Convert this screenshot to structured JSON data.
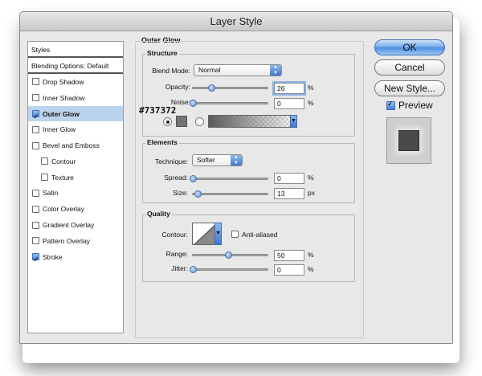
{
  "window": {
    "title": "Layer Style"
  },
  "styles_panel": {
    "header": "Styles",
    "blending_options": "Blending Options: Default",
    "items": [
      {
        "label": "Drop Shadow",
        "checked": false,
        "selected": false,
        "indent": false
      },
      {
        "label": "Inner Shadow",
        "checked": false,
        "selected": false,
        "indent": false
      },
      {
        "label": "Outer Glow",
        "checked": true,
        "selected": true,
        "indent": false
      },
      {
        "label": "Inner Glow",
        "checked": false,
        "selected": false,
        "indent": false
      },
      {
        "label": "Bevel and Emboss",
        "checked": false,
        "selected": false,
        "indent": false
      },
      {
        "label": "Contour",
        "checked": false,
        "selected": false,
        "indent": true
      },
      {
        "label": "Texture",
        "checked": false,
        "selected": false,
        "indent": true
      },
      {
        "label": "Satin",
        "checked": false,
        "selected": false,
        "indent": false
      },
      {
        "label": "Color Overlay",
        "checked": false,
        "selected": false,
        "indent": false
      },
      {
        "label": "Gradient Overlay",
        "checked": false,
        "selected": false,
        "indent": false
      },
      {
        "label": "Pattern Overlay",
        "checked": false,
        "selected": false,
        "indent": false
      },
      {
        "label": "Stroke",
        "checked": true,
        "selected": false,
        "indent": false
      }
    ]
  },
  "outer_glow": {
    "title": "Outer Glow",
    "structure": {
      "title": "Structure",
      "blend_mode_label": "Blend Mode:",
      "blend_mode_value": "Normal",
      "opacity_label": "Opacity:",
      "opacity_value": "26",
      "opacity_level": 0.26,
      "noise_label": "Noise:",
      "noise_value": "0",
      "noise_level": 0,
      "percent": "%",
      "color_annotation": "#737372",
      "glow_color": "#737372"
    },
    "elements": {
      "title": "Elements",
      "technique_label": "Technique:",
      "technique_value": "Softer",
      "spread_label": "Spread:",
      "spread_value": "0",
      "spread_level": 0,
      "spread_unit": "%",
      "size_label": "Size:",
      "size_value": "13",
      "size_level": 0.07,
      "size_unit": "px"
    },
    "quality": {
      "title": "Quality",
      "contour_label": "Contour:",
      "anti_aliased_label": "Anti-aliased",
      "range_label": "Range:",
      "range_value": "50",
      "range_level": 0.5,
      "range_unit": "%",
      "jitter_label": "Jitter:",
      "jitter_value": "0",
      "jitter_level": 0,
      "jitter_unit": "%"
    }
  },
  "buttons": {
    "ok": "OK",
    "cancel": "Cancel",
    "new_style": "New Style...",
    "preview": "Preview"
  },
  "colors": {
    "accent": "#4b8de2",
    "selection": "#bcd3ee",
    "glow": "#737372"
  }
}
